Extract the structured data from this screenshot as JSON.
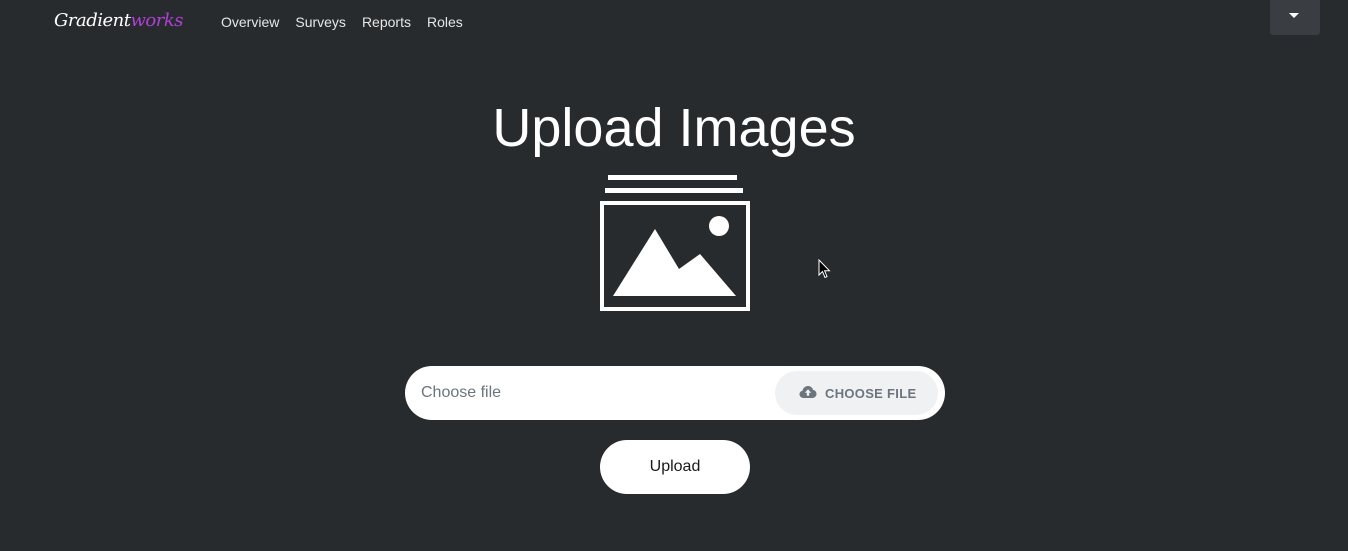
{
  "navbar": {
    "brand_part1": "Gradient",
    "brand_part2": "works",
    "links": [
      "Overview",
      "Surveys",
      "Reports",
      "Roles"
    ]
  },
  "main": {
    "title": "Upload Images",
    "file_input": {
      "placeholder": "Choose file",
      "button_label": "CHOOSE FILE",
      "button_icon": "cloud-upload-icon"
    },
    "upload_button_label": "Upload",
    "hero_icon": "image-stack-icon"
  },
  "colors": {
    "background": "#282b2e",
    "brand_accent": "#b03fd6",
    "dropdown": "#3a3d41"
  }
}
